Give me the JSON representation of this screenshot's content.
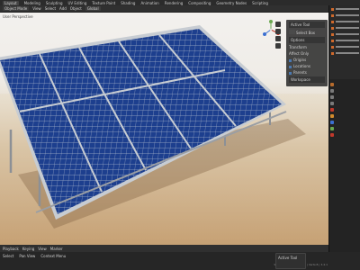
{
  "topbar": {
    "tabs": [
      "Layout",
      "Modeling",
      "Sculpting",
      "UV Editing",
      "Texture Paint",
      "Shading",
      "Animation",
      "Rendering",
      "Compositing",
      "Geometry Nodes",
      "Scripting"
    ],
    "active_index": 0
  },
  "viewport_header": {
    "mode": "Object Mode",
    "items": [
      "View",
      "Select",
      "Add",
      "Object"
    ],
    "orientation": "Global"
  },
  "viewport": {
    "label": "User Perspective"
  },
  "npanel": {
    "active_tool_title": "Active Tool",
    "tool_name": "Select Box",
    "options_title": "Options",
    "transform_label": "Transform",
    "affect_only_label": "Affect Only",
    "origins_label": "Origins",
    "locations_label": "Locations",
    "parents_label": "Parents",
    "workspace_title": "Workspace"
  },
  "bottom_toolbar": {
    "items": [
      "Playback",
      "Keying",
      "View",
      "Marker"
    ]
  },
  "statusbar": {
    "items": [
      "Select",
      "Pan View",
      "Context Menu"
    ],
    "version": "Scene Collection | Cube | Verts:8 | 3.4.1"
  },
  "floatbox": {
    "title": "Active Tool"
  },
  "colors": {
    "accent": "#4a78b0",
    "panel_bg": "#2b2b2b",
    "cell_blue": "#1b3d8a",
    "frame": "#b9bdc2"
  },
  "icons": [
    "navigation-gizmo-icon",
    "zoom-icon",
    "hand-icon",
    "camera-icon",
    "grid-icon"
  ]
}
